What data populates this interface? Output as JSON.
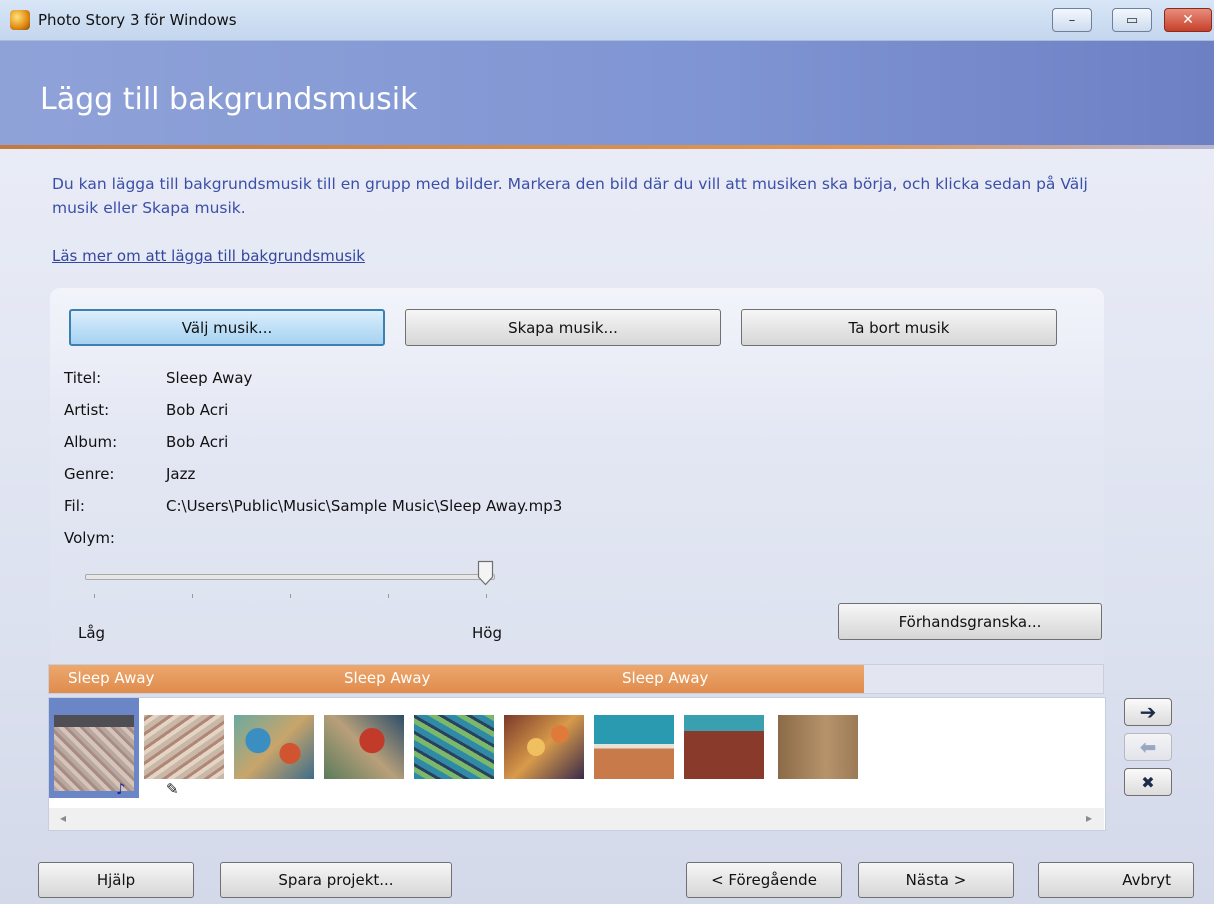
{
  "window": {
    "title": "Photo Story 3 för Windows",
    "min_glyph": "–",
    "max_glyph": "▭",
    "close_glyph": "✕"
  },
  "header": {
    "title": "Lägg till bakgrundsmusik"
  },
  "description": "Du kan lägga till bakgrundsmusik till en grupp med bilder. Markera den bild där du vill att musiken ska börja, och klicka sedan på Välj musik eller Skapa musik.",
  "learn_more": "Läs mer om att lägga till bakgrundsmusik",
  "buttons": {
    "choose_music": "Välj musik...",
    "create_music": "Skapa musik...",
    "remove_music": "Ta bort musik",
    "preview": "Förhandsgranska..."
  },
  "info": {
    "title_label": "Titel:",
    "title_value": "Sleep Away",
    "artist_label": "Artist:",
    "artist_value": "Bob Acri",
    "album_label": "Album:",
    "album_value": "Bob Acri",
    "genre_label": "Genre:",
    "genre_value": "Jazz",
    "file_label": "Fil:",
    "file_value": "C:\\Users\\Public\\Music\\Sample Music\\Sleep Away.mp3",
    "volume_label": "Volym:"
  },
  "volume": {
    "low_label": "Låg",
    "high_label": "Hög",
    "level": 1.0
  },
  "music_track": {
    "labels": [
      "Sleep Away",
      "Sleep Away",
      "Sleep Away"
    ],
    "color": "#e49455"
  },
  "thumbnails": {
    "count": 9,
    "selected_index": 0,
    "music_note_icon": "♪",
    "edit_icon": "✎"
  },
  "side_buttons": {
    "right_glyph": "➔",
    "left_glyph": "⬅",
    "remove_glyph": "✖"
  },
  "scroll": {
    "left_glyph": "◂",
    "right_glyph": "▸"
  },
  "nav": {
    "help": "Hjälp",
    "save_project": "Spara projekt...",
    "previous": "< Föregående",
    "next": "Nästa >",
    "cancel": "Avbryt"
  },
  "colors": {
    "header_start": "#8fa2d8",
    "accent_orange": "#e29651",
    "link_blue": "#3446a0",
    "selected_thumb": "#6a86c7"
  }
}
